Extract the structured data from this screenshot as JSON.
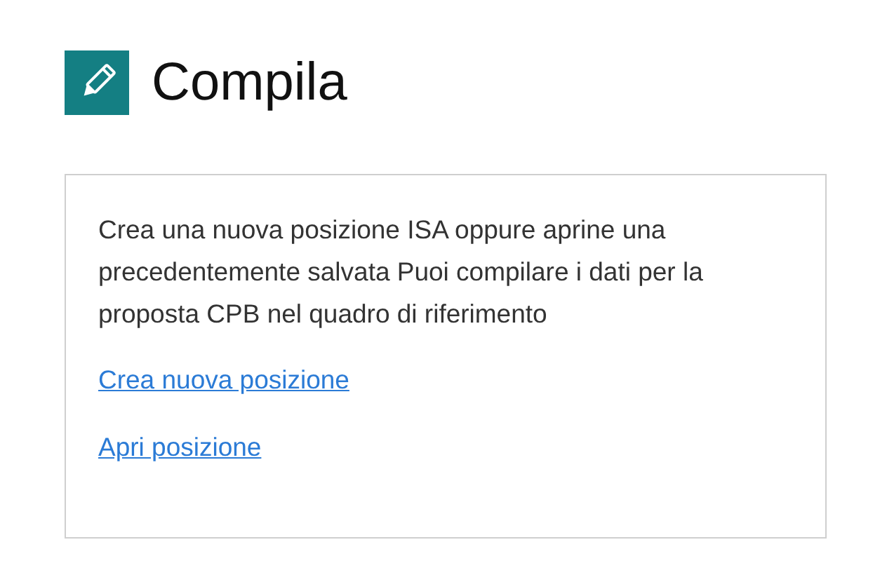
{
  "header": {
    "title": "Compila"
  },
  "card": {
    "description": "Crea una nuova posizione ISA oppure aprine una precedentemente salvata Puoi compilare i dati per la proposta CPB nel quadro di riferimento",
    "links": [
      "Crea nuova posizione",
      "Apri posizione"
    ]
  }
}
